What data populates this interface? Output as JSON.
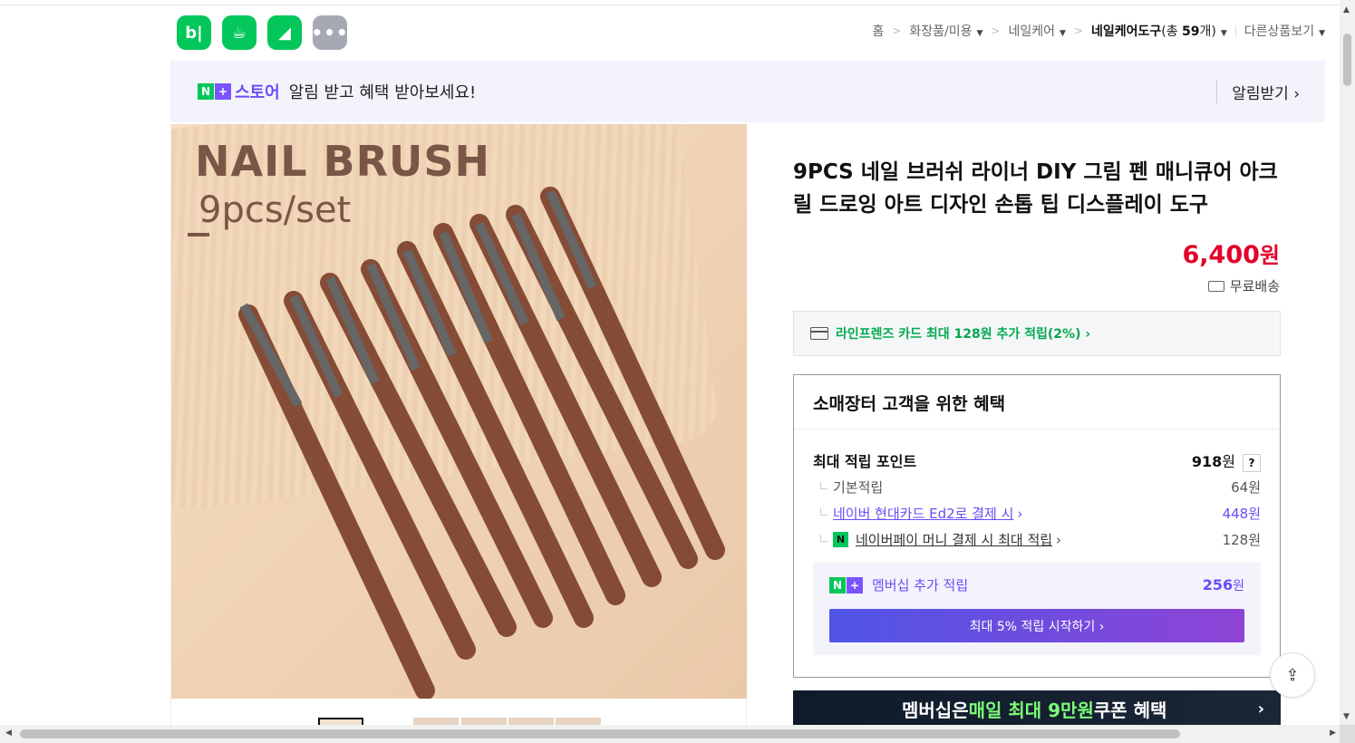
{
  "apps": [
    {
      "label": "b|",
      "icon": "blog-icon"
    },
    {
      "label": "☕",
      "icon": "cafe-icon"
    },
    {
      "label": "◢",
      "icon": "shopping-bookmark-icon"
    },
    {
      "label": "•••",
      "icon": "more-icon"
    }
  ],
  "breadcrumb": {
    "home": "홈",
    "c1": "화장품/미용",
    "c2": "네일케어",
    "c3": "네일케어도구",
    "count_prefix": "(총 ",
    "count": "59",
    "count_suffix": "개)",
    "other": "다른상품보기"
  },
  "banner": {
    "n": "N",
    "plus": "+",
    "store": "스토어",
    "text": "알림 받고 혜택 받아보세요!",
    "alarm": "알림받기 ›"
  },
  "image": {
    "title": "NAIL BRUSH",
    "subtitle": "9pcs/set"
  },
  "product": {
    "title": "9PCS 네일 브러쉬 라이너 DIY 그림 펜 매니큐어 아크릴 드로잉 아트 디자인 손톱 팁 디스플레이 도구",
    "price": "6,400",
    "price_unit": "원",
    "shipping": "무료배송"
  },
  "card_promo": "라인프렌즈 카드 최대 128원 추가 적립(2%) ›",
  "benefit": {
    "heading": "소매장터 고객을 위한 혜택",
    "max_points_label": "최대 적립 포인트",
    "max_points_value": "918",
    "unit": "원",
    "help": "?",
    "rows": [
      {
        "label": "기본적립",
        "value": "64원"
      },
      {
        "label": "네이버 현대카드 Ed2로 결제 시",
        "value": "448원"
      },
      {
        "label": "네이버페이 머니 결제 시 최대 적립",
        "value": "128원"
      }
    ],
    "membership_label": "멤버십 추가 적립",
    "membership_value": "256",
    "membership_button": "최대 5% 적립 시작하기 ›"
  },
  "promo_banner": {
    "pre": "멤버십은 ",
    "highlight": "매일 최대 9만원",
    "post": " 쿠폰 혜택",
    "arrow": "›"
  },
  "colors": {
    "price": "#e3002b",
    "naver_green": "#03c75a",
    "membership_purple": "#6c4bf6"
  }
}
